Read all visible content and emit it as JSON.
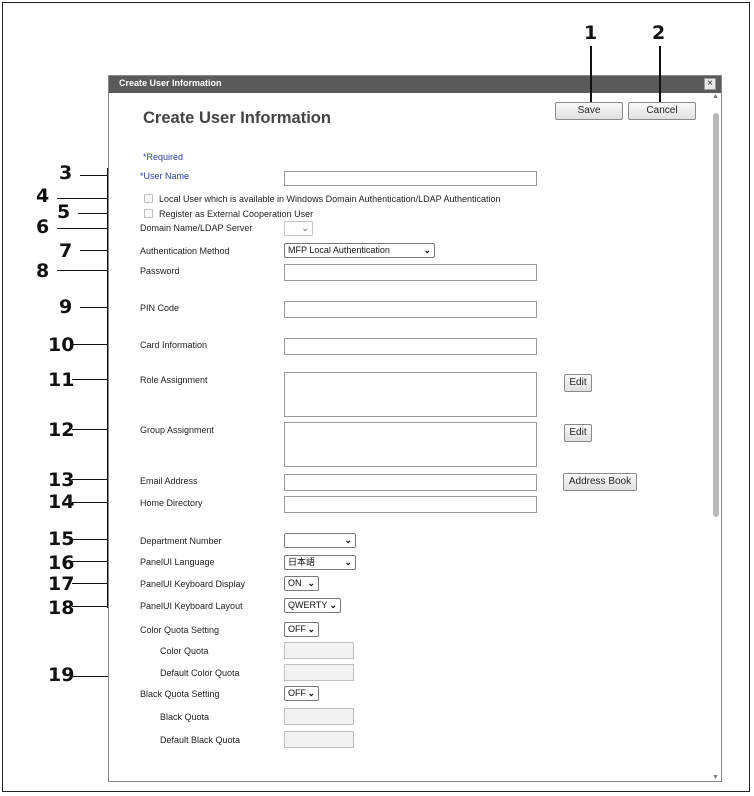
{
  "dialog": {
    "window_title": "Create User Information",
    "close_glyph": "×",
    "heading": "Create User Information",
    "save_label": "Save",
    "cancel_label": "Cancel",
    "required_note": "*Required"
  },
  "form": {
    "user_name_label": "*User Name",
    "local_user_label": "Local User which is available in Windows Domain Authentication/LDAP Authentication",
    "external_coop_label": "Register as External Cooperation User",
    "domain_label": "Domain Name/LDAP Server",
    "auth_method_label": "Authentication Method",
    "auth_method_value": "MFP Local Authentication",
    "password_label": "Password",
    "pin_label": "PIN Code",
    "card_label": "Card Information",
    "role_label": "Role Assignment",
    "role_edit_label": "Edit",
    "group_label": "Group Assignment",
    "group_edit_label": "Edit",
    "email_label": "Email Address",
    "address_book_label": "Address Book",
    "home_dir_label": "Home Directory",
    "dept_label": "Department Number",
    "dept_value": "",
    "panel_lang_label": "PanelUI Language",
    "panel_lang_value": "日本語",
    "kbd_display_label": "PanelUI Keyboard Display",
    "kbd_display_value": "ON",
    "kbd_layout_label": "PanelUI Keyboard Layout",
    "kbd_layout_value": "QWERTY",
    "color_quota_setting_label": "Color Quota Setting",
    "color_quota_setting_value": "OFF",
    "color_quota_label": "Color Quota",
    "default_color_quota_label": "Default Color Quota",
    "black_quota_setting_label": "Black Quota Setting",
    "black_quota_setting_value": "OFF",
    "black_quota_label": "Black Quota",
    "default_black_quota_label": "Default Black Quota"
  },
  "callouts": [
    "1",
    "2",
    "3",
    "4",
    "5",
    "6",
    "7",
    "8",
    "9",
    "10",
    "11",
    "12",
    "13",
    "14",
    "15",
    "16",
    "17",
    "18",
    "19"
  ],
  "icons": {
    "chevron": "chevron-down-icon",
    "scroll_up": "scroll-up-arrow-icon",
    "scroll_down": "scroll-down-arrow-icon"
  },
  "colors": {
    "titlebar": "#5a5a5a",
    "required_text": "#2740a8",
    "scroll_thumb": "#b9b9b9"
  }
}
